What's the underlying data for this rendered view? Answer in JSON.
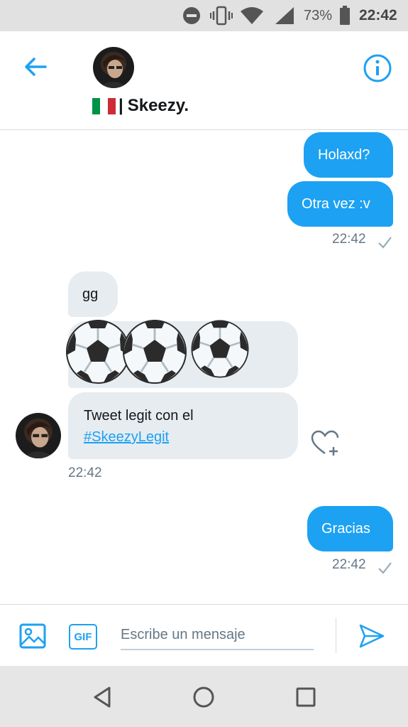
{
  "status_bar": {
    "battery_percent": "73%",
    "time": "22:42",
    "icons": [
      "do-not-disturb-icon",
      "vibrate-icon",
      "wifi-icon",
      "signal-icon",
      "battery-icon"
    ]
  },
  "header": {
    "contact_name": "Skeezy.",
    "name_separator": "|",
    "flag": "italy-flag-icon",
    "back_icon": "back-arrow-icon",
    "info_icon": "info-icon"
  },
  "messages": [
    {
      "direction": "out",
      "text": "Holaxd?"
    },
    {
      "direction": "out",
      "text": "Otra vez :v",
      "time": "22:42",
      "status": "sent-check-icon"
    },
    {
      "direction": "in",
      "text": "gg"
    },
    {
      "direction": "in",
      "emoji": "soccer-ball-icon x3"
    },
    {
      "direction": "in",
      "text": "Tweet legit con el",
      "hashtag": "#SkeezyLegit",
      "time": "22:42"
    },
    {
      "direction": "out",
      "text": "Gracias",
      "time": "22:42",
      "status": "sent-check-icon"
    }
  ],
  "composer": {
    "placeholder": "Escribe un mensaje",
    "gif_label": "GIF",
    "media_icon": "image-icon",
    "send_icon": "send-icon"
  },
  "nav": [
    "back-triangle-icon",
    "home-circle-icon",
    "recents-square-icon"
  ],
  "colors": {
    "accent": "#1da1f2",
    "incoming_bubble": "#e6ecf0",
    "status_bar": "#e1e1e1",
    "nav_bar": "#e6e6e6"
  }
}
